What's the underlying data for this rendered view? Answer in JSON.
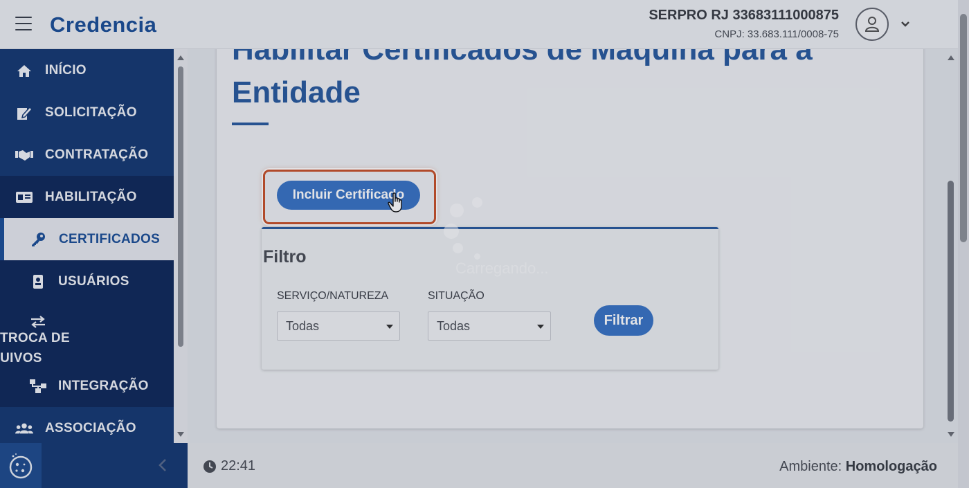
{
  "header": {
    "app_name": "Credencia",
    "org_name": "SERPRO RJ 33683111000875",
    "org_cnpj": "CNPJ: 33.683.111/0008-75"
  },
  "sidebar": {
    "items": [
      {
        "label": "INÍCIO",
        "icon": "home-icon"
      },
      {
        "label": "SOLICITAÇÃO",
        "icon": "edit-icon"
      },
      {
        "label": "CONTRATAÇÃO",
        "icon": "handshake-icon"
      },
      {
        "label": "HABILITAÇÃO",
        "icon": "id-card-icon"
      },
      {
        "label": "CERTIFICADOS",
        "icon": "key-icon"
      },
      {
        "label": "USUÁRIOS",
        "icon": "user-badge-icon"
      },
      {
        "label_line1": "TROCA DE",
        "label_line2": "ARQUIVOS",
        "icon": "exchange-icon"
      },
      {
        "label": "INTEGRAÇÃO",
        "icon": "sitemap-icon"
      },
      {
        "label": "ASSOCIAÇÃO",
        "icon": "users-icon"
      }
    ]
  },
  "main": {
    "title": "Habilitar Certificados de Máquina para a Entidade",
    "include_button": "Incluir Certificado",
    "filter": {
      "title": "Filtro",
      "servico_label": "SERVIÇO/NATUREZA",
      "servico_value": "Todas",
      "situacao_label": "SITUAÇÃO",
      "situacao_value": "Todas",
      "submit_label": "Filtrar"
    },
    "loading_text": "Carregando..."
  },
  "footer": {
    "time": "22:41",
    "ambiente_label": "Ambiente:",
    "ambiente_value": "Homologação"
  },
  "colors": {
    "brand": "#1c4f97",
    "sidebar_bg": "#163a72",
    "sidebar_sub_bg": "#10295a",
    "button": "#3a74c4",
    "highlight": "#c8512a"
  }
}
